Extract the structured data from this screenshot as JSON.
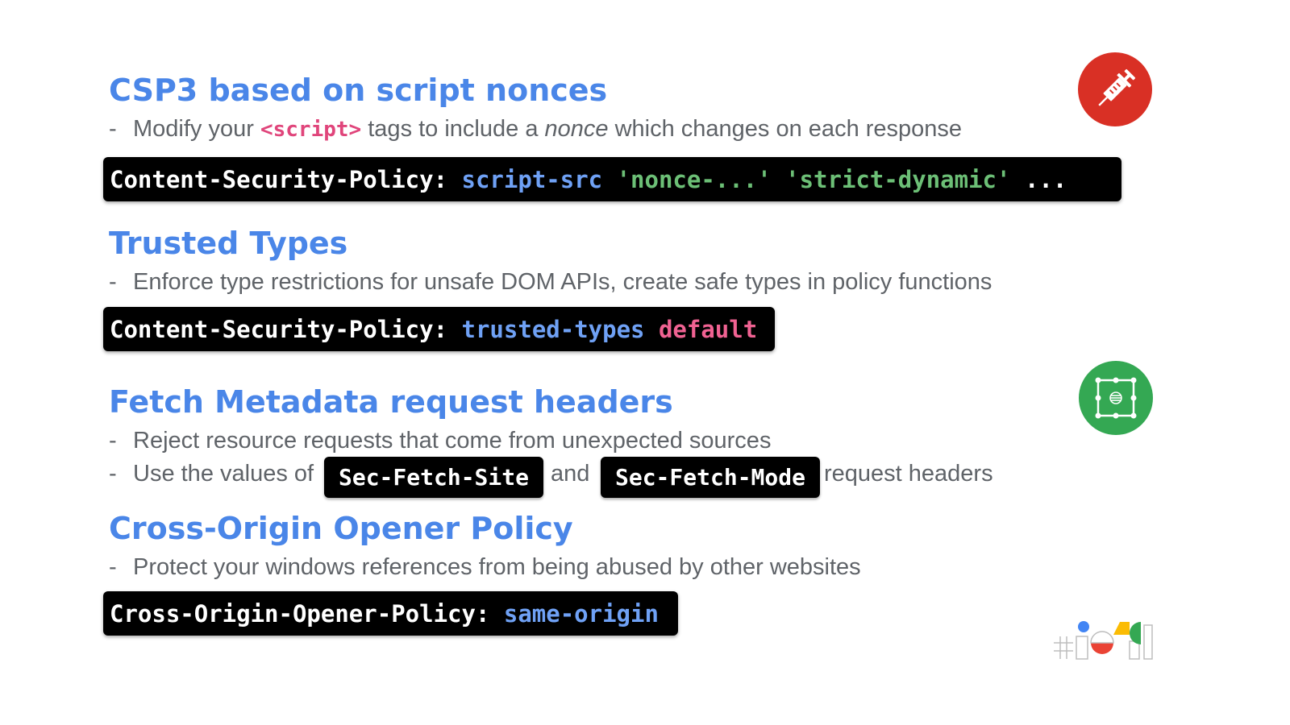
{
  "sections": {
    "csp": {
      "title": "CSP3 based on script nonces",
      "bullet": {
        "before": "Modify your",
        "code": "<script>",
        "middle": "tags to include a",
        "emph": "nonce",
        "after": "which changes on each response"
      },
      "code": {
        "header": "Content-Security-Policy",
        "colon": ":",
        "directive": "script-src",
        "nonce": "'nonce-...'",
        "strict": "'strict-dynamic'",
        "ellipsis": "..."
      }
    },
    "trusted_types": {
      "title": "Trusted Types",
      "bullet": "Enforce type restrictions for unsafe DOM APIs, create safe types in policy functions",
      "code": {
        "header": "Content-Security-Policy",
        "colon": ":",
        "directive": "trusted-types",
        "value": "default"
      }
    },
    "fetch_metadata": {
      "title": "Fetch Metadata request headers",
      "bullet1": "Reject resource requests that come from unexpected sources",
      "bullet2": {
        "before": "Use the values of",
        "code1": "Sec-Fetch-Site",
        "middle": "and",
        "code2": "Sec-Fetch-Mode",
        "after": "request headers"
      }
    },
    "coop": {
      "title": "Cross-Origin Opener Policy",
      "bullet": "Protect your windows references from being abused by other websites",
      "code": {
        "header": "Cross-Origin-Opener-Policy:",
        "value": "same-origin"
      }
    }
  },
  "dash": "-",
  "icons": {
    "syringe": "syringe-icon",
    "frame": "selection-frame-icon",
    "logo": "google-io-logo"
  },
  "colors": {
    "heading": "#4a86e8",
    "body_text": "#5f6368",
    "code_bg": "#000000",
    "code_blue": "#6fa1f5",
    "code_green": "#6cbf76",
    "code_pink": "#f06292",
    "red_badge": "#d93025",
    "green_badge": "#34a853"
  }
}
